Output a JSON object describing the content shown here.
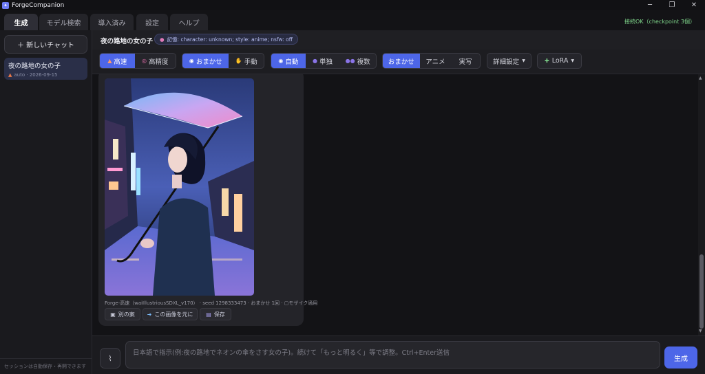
{
  "window": {
    "title": "ForgeCompanion",
    "minimize": "─",
    "maximize": "❐",
    "close": "✕"
  },
  "tabs": [
    {
      "label": "生成",
      "active": true
    },
    {
      "label": "モデル検索"
    },
    {
      "label": "導入済み"
    },
    {
      "label": "設定"
    },
    {
      "label": "ヘルプ"
    }
  ],
  "connection_status": "接続OK（checkpoint 3個）",
  "sidebar": {
    "new_chat_label": "＋ 新しいチャット",
    "chats": [
      {
        "title": "夜の路地の女の子",
        "meta": "auto · 2026-09-15"
      }
    ],
    "footer": "セッションは自動保存・再開できます"
  },
  "header": {
    "title": "夜の路地の女の子",
    "memory": "記憶: character: unknown; style: anime; nsfw: off"
  },
  "toolbar": {
    "speed": [
      "高速",
      "高精度"
    ],
    "mode": [
      "おまかせ",
      "手動"
    ],
    "count": [
      "自動",
      "単独",
      "複数"
    ],
    "style": [
      "おまかせ",
      "アニメ",
      "実写"
    ],
    "advanced": "詳細設定",
    "lora": "LoRA"
  },
  "message": {
    "meta": "Forge-高速（waiIllustriousSDXL_v170） · seed 1298333473 · おまかせ 1回 · ▢モザイク適用",
    "actions": [
      "別の案",
      "この画像を元に",
      "保存"
    ]
  },
  "composer": {
    "placeholder": "日本語で指示(例:夜の路地でネオンの傘をさす女の子)。続けて「もっと明るく」等で調整。Ctrl+Enter送信",
    "send_label": "生成"
  }
}
